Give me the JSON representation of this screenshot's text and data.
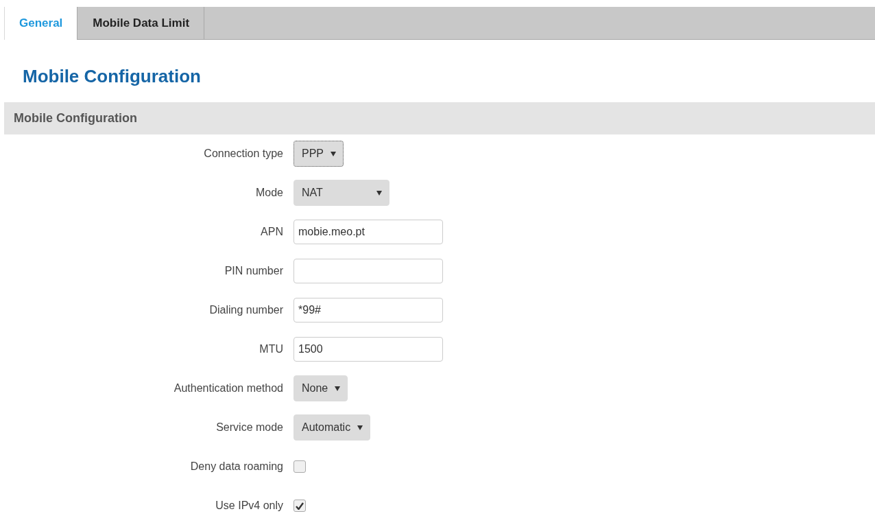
{
  "tabs": [
    {
      "label": "General",
      "selected": true
    },
    {
      "label": "Mobile Data Limit",
      "selected": false
    }
  ],
  "page_title": "Mobile Configuration",
  "section": {
    "title": "Mobile Configuration",
    "fields": [
      {
        "kind": "select",
        "label": "Connection type",
        "value": "PPP",
        "focused": true
      },
      {
        "kind": "select",
        "label": "Mode",
        "value": "NAT",
        "focused": false,
        "wide": true
      },
      {
        "kind": "text",
        "label": "APN",
        "value": "mobie.meo.pt"
      },
      {
        "kind": "text",
        "label": "PIN number"
      },
      {
        "kind": "text",
        "label": "Dialing number",
        "value": "*99#"
      },
      {
        "kind": "text",
        "label": "MTU",
        "value": "1500"
      },
      {
        "kind": "select",
        "label": "Authentication method",
        "value": "None",
        "focused": false
      },
      {
        "kind": "select",
        "label": "Service mode",
        "value": "Automatic",
        "focused": false
      },
      {
        "kind": "checkbox",
        "label": "Deny data roaming",
        "checked": false
      },
      {
        "kind": "checkbox",
        "label": "Use IPv4 only",
        "checked": true
      }
    ]
  }
}
